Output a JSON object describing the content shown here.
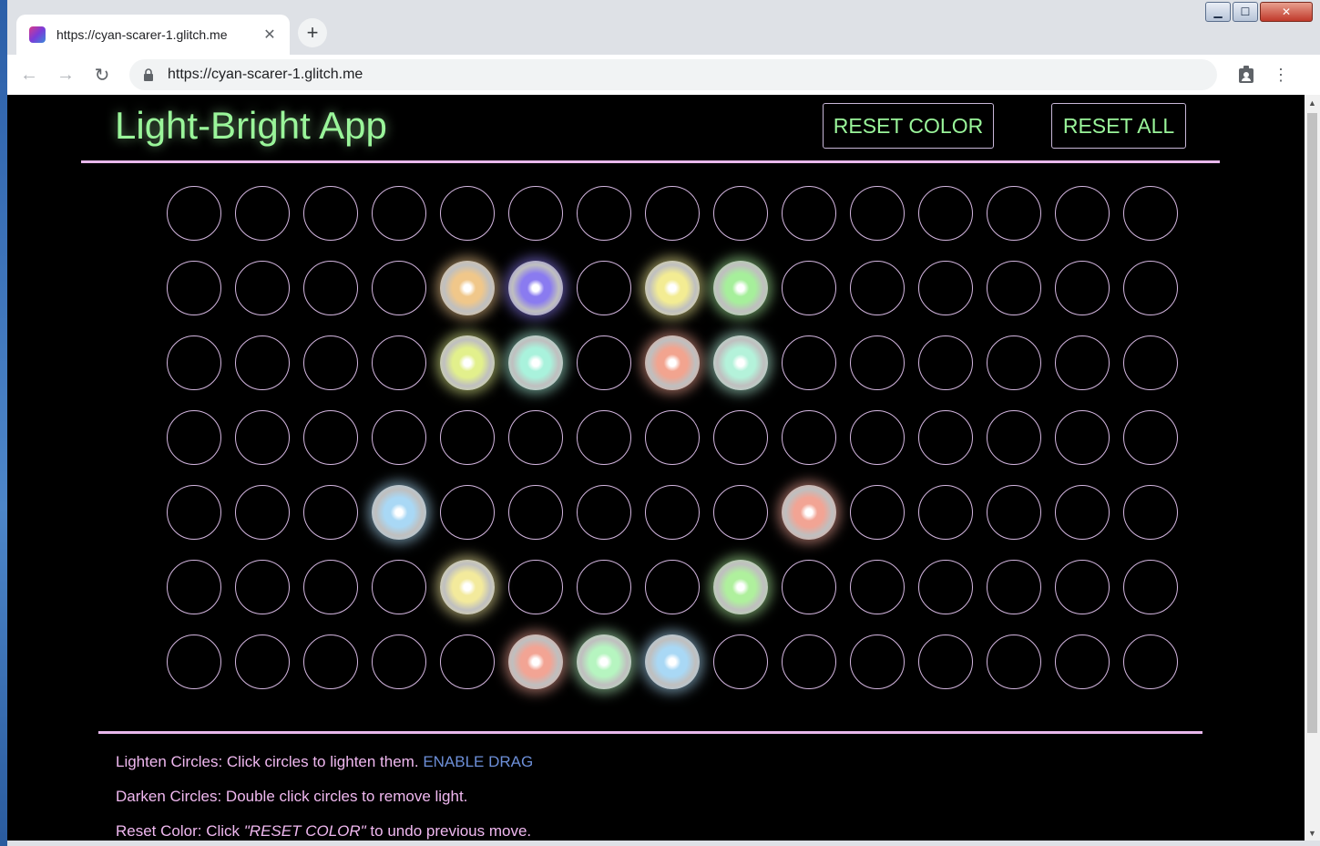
{
  "browser": {
    "tab_title": "https://cyan-scarer-1.glitch.me",
    "url": "https://cyan-scarer-1.glitch.me",
    "window_controls": {
      "minimize": "▁",
      "maximize": "☐",
      "close": "✕"
    }
  },
  "app": {
    "title": "Light-Bright App",
    "reset_color_label": "RESET COLOR",
    "reset_all_label": "RESET ALL"
  },
  "grid": {
    "rows": 7,
    "cols": 15,
    "lit": [
      {
        "row": 1,
        "col": 4,
        "color": "#f0c78a"
      },
      {
        "row": 1,
        "col": 5,
        "color": "#8a7bf0"
      },
      {
        "row": 1,
        "col": 7,
        "color": "#f3ec93"
      },
      {
        "row": 1,
        "col": 8,
        "color": "#a6ef9b"
      },
      {
        "row": 2,
        "col": 4,
        "color": "#e2f08c"
      },
      {
        "row": 2,
        "col": 5,
        "color": "#a9f2dc"
      },
      {
        "row": 2,
        "col": 7,
        "color": "#f2a48f"
      },
      {
        "row": 2,
        "col": 8,
        "color": "#b4f2da"
      },
      {
        "row": 4,
        "col": 3,
        "color": "#a9d8f5"
      },
      {
        "row": 4,
        "col": 9,
        "color": "#f2a494"
      },
      {
        "row": 5,
        "col": 4,
        "color": "#f3ea9c"
      },
      {
        "row": 5,
        "col": 8,
        "color": "#aff09d"
      },
      {
        "row": 6,
        "col": 5,
        "color": "#f2a494"
      },
      {
        "row": 6,
        "col": 6,
        "color": "#b6f5c0"
      },
      {
        "row": 6,
        "col": 7,
        "color": "#a9d8f5"
      }
    ],
    "outline_color": "#d4b6e0"
  },
  "instructions": {
    "lighten_text": "Lighten Circles: Click circles to lighten them.",
    "enable_drag": "ENABLE DRAG",
    "darken_text": "Darken Circles: Double click circles to remove light.",
    "reset_color_prefix": "Reset Color: Click ",
    "reset_color_em": "\"RESET COLOR\"",
    "reset_color_suffix": " to undo previous move."
  },
  "colors": {
    "title_green": "#9af59a",
    "divider_pink": "#e8b8ec",
    "instruction_pink": "#f0b8f0",
    "link_blue": "#6d8fd8"
  }
}
